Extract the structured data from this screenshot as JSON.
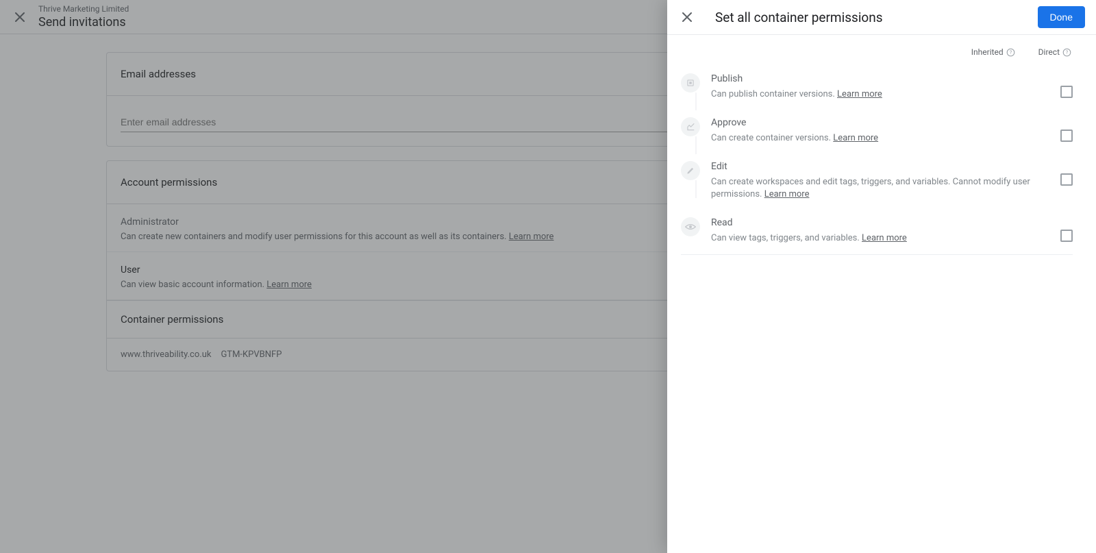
{
  "base": {
    "subtitle": "Thrive Marketing Limited",
    "title": "Send invitations",
    "email_section": {
      "header": "Email addresses",
      "placeholder": "Enter email addresses"
    },
    "account_permissions": {
      "header": "Account permissions",
      "items": [
        {
          "title": "Administrator",
          "desc": "Can create new containers and modify user permissions for this account as well as its containers. ",
          "learn": "Learn more"
        },
        {
          "title": "User",
          "desc": "Can view basic account information. ",
          "learn": "Learn more"
        }
      ]
    },
    "container_permissions": {
      "header": "Container permissions",
      "rows": [
        {
          "domain": "www.thriveability.co.uk",
          "id": "GTM-KPVBNFP"
        }
      ]
    }
  },
  "panel": {
    "title": "Set all container permissions",
    "done_label": "Done",
    "columns": {
      "inherited": "Inherited",
      "direct": "Direct"
    },
    "permissions": [
      {
        "icon": "publish-icon",
        "name": "Publish",
        "desc": "Can publish container versions. ",
        "learn": "Learn more"
      },
      {
        "icon": "approve-icon",
        "name": "Approve",
        "desc": "Can create container versions. ",
        "learn": "Learn more"
      },
      {
        "icon": "edit-icon",
        "name": "Edit",
        "desc": "Can create workspaces and edit tags, triggers, and variables. Cannot modify user permissions. ",
        "learn": "Learn more"
      },
      {
        "icon": "read-icon",
        "name": "Read",
        "desc": "Can view tags, triggers, and variables. ",
        "learn": "Learn more"
      }
    ]
  }
}
